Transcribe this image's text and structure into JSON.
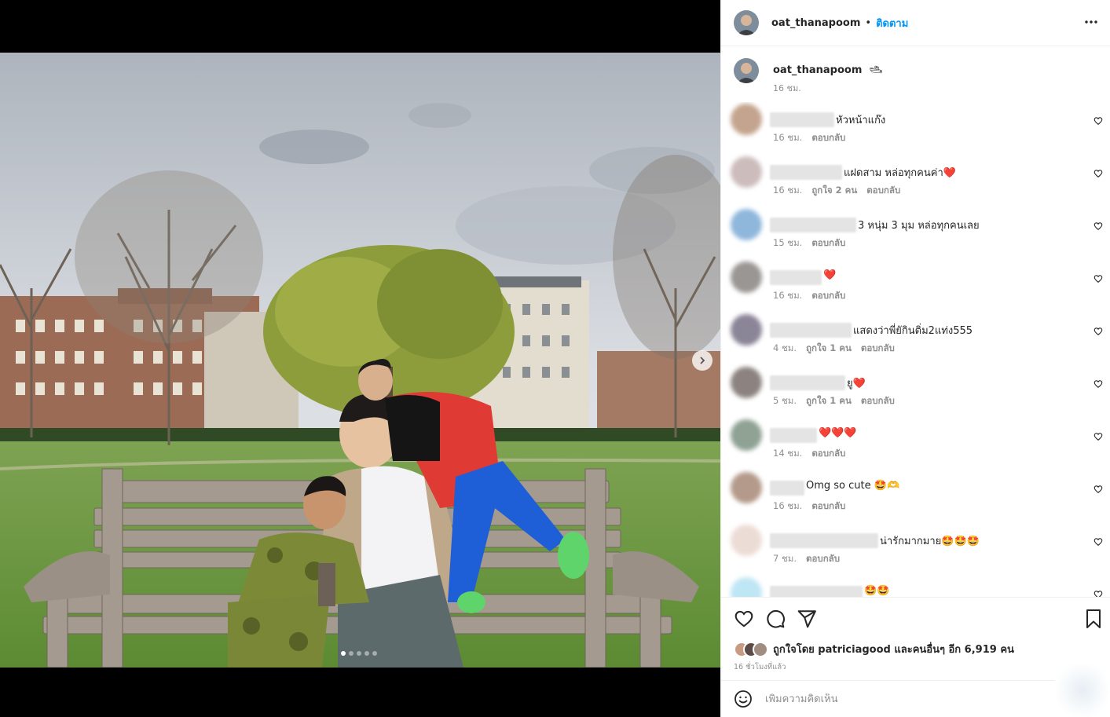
{
  "post": {
    "username": "oat_thanapoom",
    "follow_label": "ติดตาม",
    "bullet": "•",
    "caption_emoji": "🛥",
    "caption_time": "16 ชม."
  },
  "comments": [
    {
      "text": "หัวหน้าแก๊ง",
      "meta": [
        "16 ชม."
      ],
      "reply": "ตอบกลับ",
      "avatar_color": "#c4a48e"
    },
    {
      "text": "แฝดสาม หล่อทุกคนค่า❤️",
      "meta": [
        "16 ชม."
      ],
      "likes": "ถูกใจ 2 คน",
      "reply": "ตอบกลับ",
      "avatar_color": "#cdbcbc"
    },
    {
      "text": "3 หนุ่ม 3 มุม หล่อทุกคนเลย",
      "meta": [
        "15 ชม."
      ],
      "reply": "ตอบกลับ",
      "avatar_color": "#8fb7dc"
    },
    {
      "text": "❤️",
      "meta": [
        "16 ชม."
      ],
      "reply": "ตอบกลับ",
      "avatar_color": "#9a9694"
    },
    {
      "text": "แสดงว่าพี่ยักินติ่ม2แท่ง555",
      "meta": [
        "4 ชม."
      ],
      "likes": "ถูกใจ 1 คน",
      "reply": "ตอบกลับ",
      "avatar_color": "#8b8598"
    },
    {
      "text": "ยู❤️",
      "meta": [
        "5 ชม."
      ],
      "likes": "ถูกใจ 1 คน",
      "reply": "ตอบกลับ",
      "avatar_color": "#8c8380"
    },
    {
      "text": "❤️❤️❤️",
      "meta": [
        "14 ชม."
      ],
      "reply": "ตอบกลับ",
      "avatar_color": "#8fa294"
    },
    {
      "text": "Omg so cute 🤩🫶",
      "meta": [
        "16 ชม."
      ],
      "reply": "ตอบกลับ",
      "avatar_color": "#b49a8a"
    },
    {
      "text": "น่ารักมากมาย🤩🤩🤩",
      "meta": [
        "7 ชม."
      ],
      "reply": "ตอบกลับ",
      "avatar_color": "#ecdcd6"
    },
    {
      "text": "🤩🤩",
      "meta": [],
      "reply": "",
      "avatar_color": "#bfe6f5"
    }
  ],
  "likes": {
    "text": "ถูกใจโดย patriciagood และคนอื่นๆ อีก 6,919 คน",
    "time": "16 ชั่วโมงที่แล้ว"
  },
  "comment_box": {
    "placeholder": "เพิ่มความคิดเห็น"
  },
  "carousel": {
    "total": 5,
    "current": 1
  },
  "colors": {
    "link": "#0095f6",
    "heart": "#e0112b",
    "muted": "#8e8e8e"
  },
  "icons": [
    "next-arrow-icon",
    "more-options-icon",
    "heart-icon",
    "comment-icon",
    "share-icon",
    "bookmark-icon",
    "emoji-icon",
    "speedboat-emoji"
  ]
}
